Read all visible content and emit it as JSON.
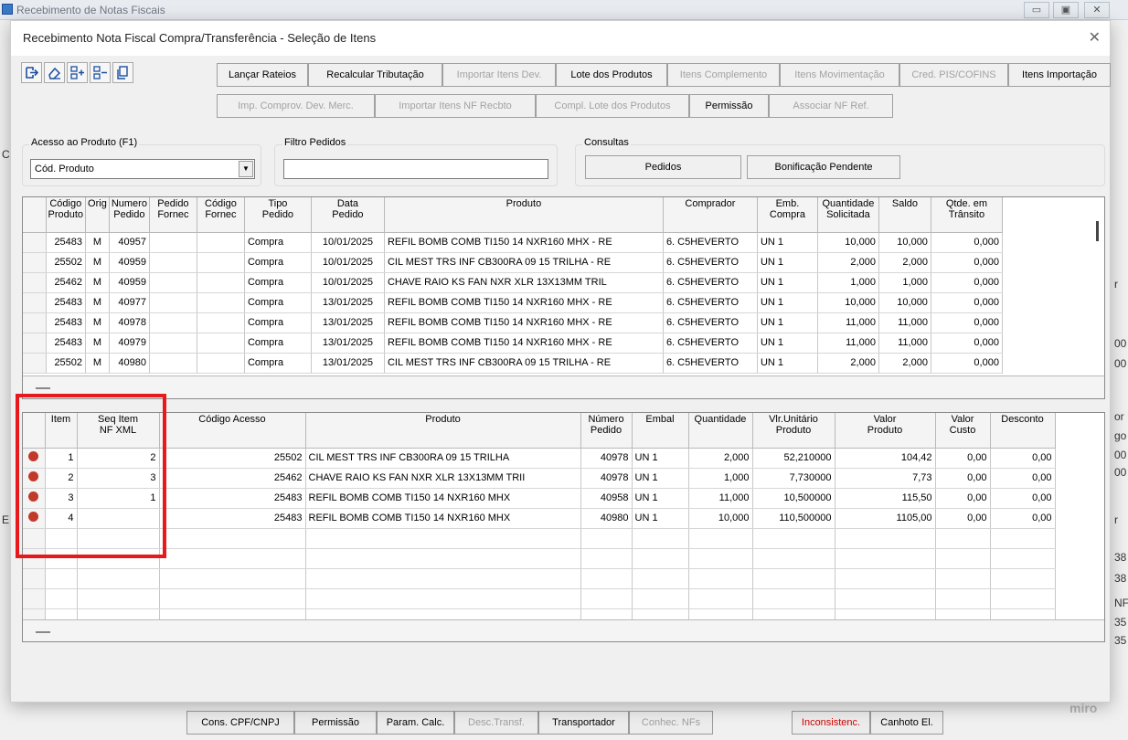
{
  "outer": {
    "title": "Recebimento de Notas Fiscais",
    "min_btn": "▭",
    "max_btn": "▣",
    "close_btn": "✕",
    "left_letters": [
      "C",
      "E"
    ],
    "right_frag": [
      "r",
      "00",
      "00",
      "or",
      "go",
      "00",
      "00",
      "r",
      "38",
      "38",
      "NF",
      "35",
      "35"
    ]
  },
  "bottom_bar": {
    "buttons": [
      {
        "label": "Cons. CPF/CNPJ",
        "state": "normal"
      },
      {
        "label": "Permissão",
        "state": "normal"
      },
      {
        "label": "Param. Calc.",
        "state": "normal"
      },
      {
        "label": "Desc.Transf.",
        "state": "disabled"
      },
      {
        "label": "Transportador",
        "state": "normal"
      },
      {
        "label": "Conhec. NFs",
        "state": "disabled"
      },
      {
        "label": "Inconsistenc.",
        "state": "red"
      },
      {
        "label": "Canhoto El.",
        "state": "normal"
      }
    ],
    "watermark": "miro"
  },
  "dialog": {
    "title": "Recebimento Nota Fiscal Compra/Transferência - Seleção de Itens",
    "close": "✕",
    "toolbar_icons": [
      "exit-icon",
      "eraser-icon",
      "add-rows-icon",
      "remove-rows-icon",
      "copy-icon"
    ],
    "buttons_row1": [
      {
        "label": "Lançar Rateios",
        "enabled": true
      },
      {
        "label": "Recalcular Tributação",
        "enabled": true
      },
      {
        "label": "Importar Itens Dev.",
        "enabled": false
      },
      {
        "label": "Lote dos Produtos",
        "enabled": true
      },
      {
        "label": "Itens Complemento",
        "enabled": false
      },
      {
        "label": "Itens Movimentação",
        "enabled": false
      },
      {
        "label": "Cred. PIS/COFINS",
        "enabled": false
      },
      {
        "label": "Itens Importação",
        "enabled": true
      }
    ],
    "buttons_row2": [
      {
        "label": "Imp. Comprov. Dev. Merc.",
        "enabled": false
      },
      {
        "label": "Importar Itens NF Recbto",
        "enabled": false
      },
      {
        "label": "Compl. Lote dos Produtos",
        "enabled": false
      },
      {
        "label": "Permissão",
        "enabled": true
      },
      {
        "label": "Associar NF Ref.",
        "enabled": false
      }
    ],
    "acesso": {
      "label": "Acesso ao Produto (F1)",
      "value": "Cód. Produto"
    },
    "filtro": {
      "label": "Filtro Pedidos",
      "value": ""
    },
    "consultas": {
      "label": "Consultas",
      "pedidos": "Pedidos",
      "bonificacao": "Bonificação Pendente"
    }
  },
  "orders_grid": {
    "headers": [
      "Código\nProduto",
      "Orig",
      "Numero\nPedido",
      "Pedido\nFornec",
      "Código\nFornec",
      "Tipo\nPedido",
      "Data\nPedido",
      "Produto",
      "Comprador",
      "Emb.\nCompra",
      "Quantidade\nSolicitada",
      "Saldo",
      "Qtde. em\nTrânsito"
    ],
    "rows": [
      [
        "25483",
        "M",
        "40957",
        "",
        "",
        "Compra",
        "10/01/2025",
        "REFIL BOMB COMB TI150 14 NXR160 MHX - RE",
        "6. C5HEVERTO",
        "UN 1",
        "10,000",
        "10,000",
        "0,000"
      ],
      [
        "25502",
        "M",
        "40959",
        "",
        "",
        "Compra",
        "10/01/2025",
        "CIL MEST TRS INF CB300RA 09 15 TRILHA - RE",
        "6. C5HEVERTO",
        "UN 1",
        "2,000",
        "2,000",
        "0,000"
      ],
      [
        "25462",
        "M",
        "40959",
        "",
        "",
        "Compra",
        "10/01/2025",
        "CHAVE RAIO KS FAN NXR XLR 13X13MM TRIL",
        "6. C5HEVERTO",
        "UN 1",
        "1,000",
        "1,000",
        "0,000"
      ],
      [
        "25483",
        "M",
        "40977",
        "",
        "",
        "Compra",
        "13/01/2025",
        "REFIL BOMB COMB TI150 14 NXR160 MHX - RE",
        "6. C5HEVERTO",
        "UN 1",
        "10,000",
        "10,000",
        "0,000"
      ],
      [
        "25483",
        "M",
        "40978",
        "",
        "",
        "Compra",
        "13/01/2025",
        "REFIL BOMB COMB TI150 14 NXR160 MHX - RE",
        "6. C5HEVERTO",
        "UN 1",
        "11,000",
        "11,000",
        "0,000"
      ],
      [
        "25483",
        "M",
        "40979",
        "",
        "",
        "Compra",
        "13/01/2025",
        "REFIL BOMB COMB TI150 14 NXR160 MHX - RE",
        "6. C5HEVERTO",
        "UN 1",
        "11,000",
        "11,000",
        "0,000"
      ],
      [
        "25502",
        "M",
        "40980",
        "",
        "",
        "Compra",
        "13/01/2025",
        "CIL MEST TRS INF CB300RA 09 15 TRILHA - RE",
        "6. C5HEVERTO",
        "UN 1",
        "2,000",
        "2,000",
        "0,000"
      ]
    ]
  },
  "items_grid": {
    "headers": [
      "Item",
      "Seq Item\nNF XML",
      "Código Acesso",
      "Produto",
      "Número\nPedido",
      "Embal",
      "Quantidade",
      "Vlr.Unitário\nProduto",
      "Valor\nProduto",
      "Valor\nCusto",
      "Desconto"
    ],
    "rows": [
      [
        "1",
        "2",
        "25502",
        "CIL MEST TRS INF CB300RA 09 15 TRILHA",
        "40978",
        "UN 1",
        "2,000",
        "52,210000",
        "104,42",
        "0,00",
        "0,00"
      ],
      [
        "2",
        "3",
        "25462",
        "CHAVE RAIO KS FAN NXR XLR 13X13MM TRII",
        "40978",
        "UN 1",
        "1,000",
        "7,730000",
        "7,73",
        "0,00",
        "0,00"
      ],
      [
        "3",
        "1",
        "25483",
        "REFIL BOMB COMB TI150 14 NXR160 MHX",
        "40958",
        "UN 1",
        "11,000",
        "10,500000",
        "115,50",
        "0,00",
        "0,00"
      ],
      [
        "4",
        "",
        "25483",
        "REFIL BOMB COMB TI150 14 NXR160 MHX",
        "40980",
        "UN 1",
        "10,000",
        "110,500000",
        "1105,00",
        "0,00",
        "0,00"
      ]
    ],
    "empty_rows": 5,
    "status_color": "#c0392b"
  },
  "highlight_color": "#e8191d"
}
